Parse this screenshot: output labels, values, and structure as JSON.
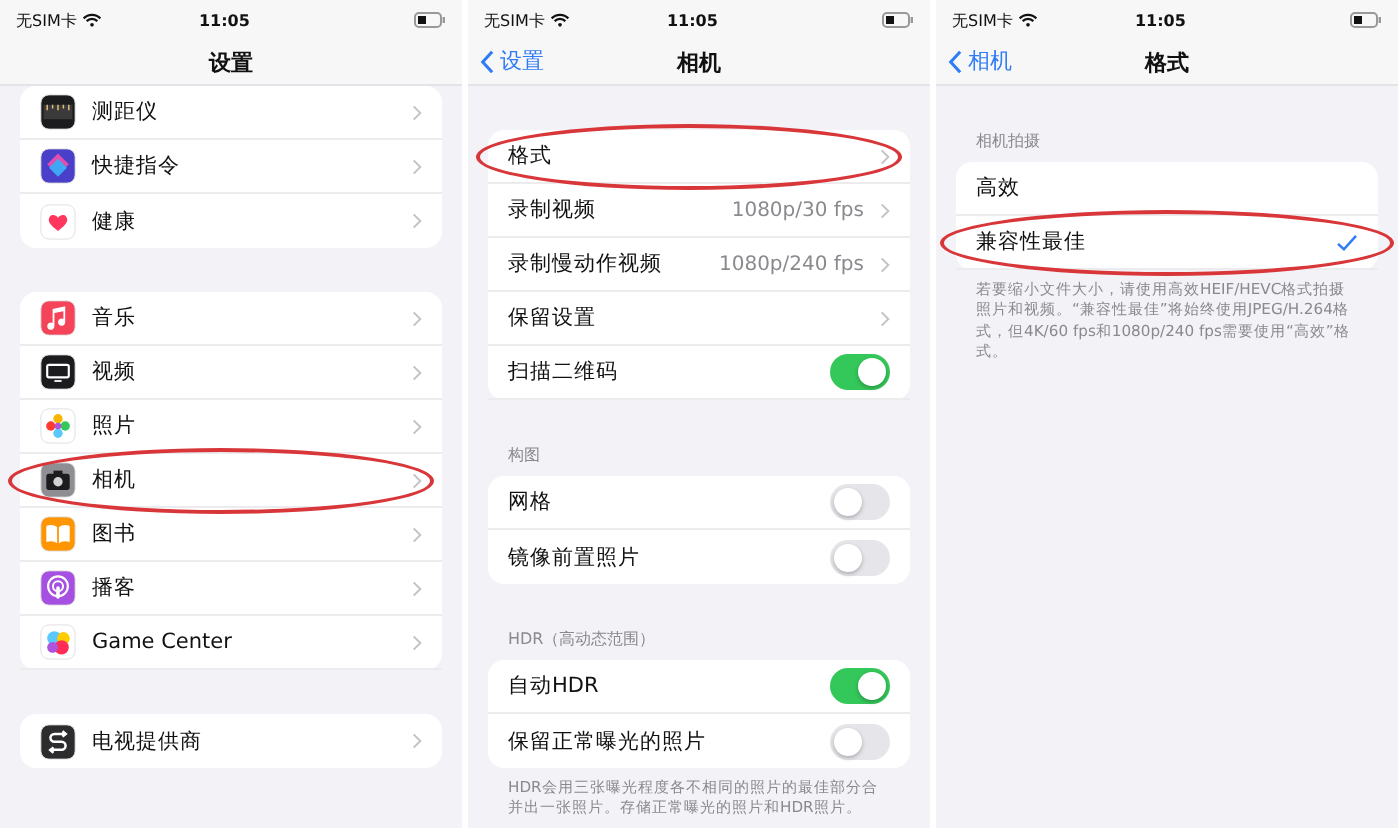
{
  "screens": [
    {
      "status_bar": {
        "carrier": "无SIM卡",
        "time": "11:05"
      },
      "nav": {
        "title": "设置"
      },
      "sections": [
        {
          "rows": [
            {
              "label": "测距仪",
              "kind": "link",
              "color": "#1c1c1e",
              "circled": false
            },
            {
              "label": "快捷指令",
              "kind": "link",
              "color": "#4a3fc9",
              "circled": false
            },
            {
              "label": "健康",
              "kind": "link",
              "color": "#ffffff",
              "circled": false
            }
          ]
        },
        {
          "rows": [
            {
              "label": "音乐",
              "kind": "link",
              "color": "#f5435a",
              "circled": false
            },
            {
              "label": "视频",
              "kind": "link",
              "color": "#1c1c1e",
              "circled": false
            },
            {
              "label": "照片",
              "kind": "link",
              "color": "#ffffff",
              "circled": false
            },
            {
              "label": "相机",
              "kind": "link",
              "color": "#8e8e93",
              "circled": true
            },
            {
              "label": "图书",
              "kind": "link",
              "color": "#ff9500",
              "circled": false
            },
            {
              "label": "播客",
              "kind": "link",
              "color": "#a550e0",
              "circled": false
            },
            {
              "label": "Game Center",
              "kind": "link",
              "color": "#ffffff",
              "circled": false
            }
          ]
        },
        {
          "rows": [
            {
              "label": "电视提供商",
              "kind": "link",
              "color": "#2c2c2e",
              "circled": false
            }
          ]
        }
      ]
    },
    {
      "status_bar": {
        "carrier": "无SIM卡",
        "time": "11:05"
      },
      "nav": {
        "back": "设置",
        "title": "相机"
      },
      "sections": [
        {
          "rows": [
            {
              "label": "格式",
              "kind": "link",
              "circled": true
            },
            {
              "label": "录制视频",
              "kind": "link",
              "value": "1080p/30 fps",
              "circled": false
            },
            {
              "label": "录制慢动作视频",
              "kind": "link",
              "value": "1080p/240 fps",
              "circled": false
            },
            {
              "label": "保留设置",
              "kind": "link",
              "circled": false
            },
            {
              "label": "扫描二维码",
              "kind": "toggle",
              "on": true,
              "circled": false
            }
          ]
        },
        {
          "header": "构图",
          "rows": [
            {
              "label": "网格",
              "kind": "toggle",
              "on": false,
              "circled": false
            },
            {
              "label": "镜像前置照片",
              "kind": "toggle",
              "on": false,
              "circled": false
            }
          ]
        },
        {
          "header": "HDR（高动态范围）",
          "rows": [
            {
              "label": "自动HDR",
              "kind": "toggle",
              "on": true,
              "circled": false
            },
            {
              "label": "保留正常曝光的照片",
              "kind": "toggle",
              "on": false,
              "circled": false
            }
          ],
          "footer": "HDR会用三张曝光程度各不相同的照片的最佳部分合并出一张照片。存储正常曝光的照片和HDR照片。"
        }
      ]
    },
    {
      "status_bar": {
        "carrier": "无SIM卡",
        "time": "11:05"
      },
      "nav": {
        "back": "相机",
        "title": "格式"
      },
      "sections": [
        {
          "header": "相机拍摄",
          "rows": [
            {
              "label": "高效",
              "kind": "check",
              "selected": false,
              "circled": false
            },
            {
              "label": "兼容性最佳",
              "kind": "check",
              "selected": true,
              "circled": true
            }
          ],
          "footer": "若要缩小文件大小，请使用高效HEIF/HEVC格式拍摄照片和视频。“兼容性最佳”将始终使用JPEG/H.264格式，但4K/60 fps和1080p/240 fps需要使用“高效”格式。"
        }
      ]
    }
  ]
}
